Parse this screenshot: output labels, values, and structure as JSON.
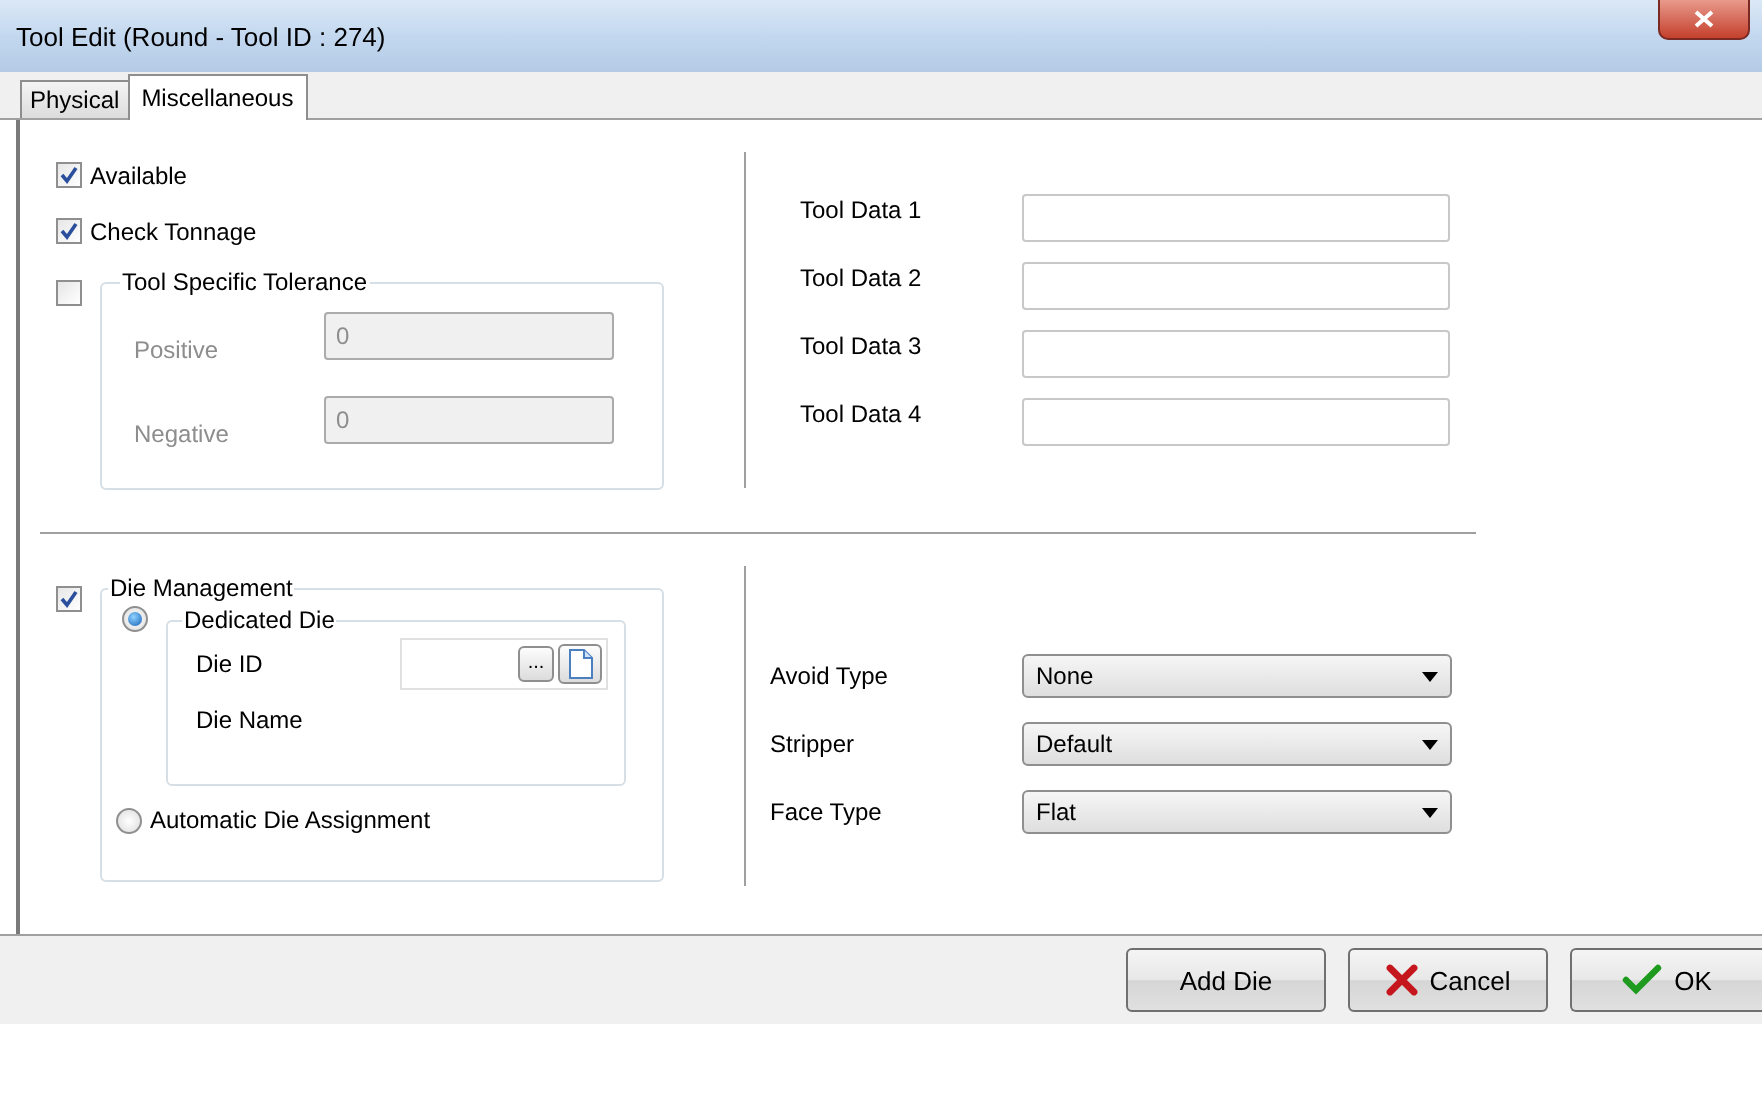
{
  "window": {
    "title": "Tool Edit (Round - Tool ID : 274)"
  },
  "tabs": [
    {
      "label": "Physical",
      "selected": false
    },
    {
      "label": "Miscellaneous",
      "selected": true
    }
  ],
  "options": [
    {
      "label": "Available",
      "checked": true
    },
    {
      "label": "Check Tonnage",
      "checked": true
    }
  ],
  "tolerance": {
    "title": "Tool Specific Tolerance",
    "checked": false,
    "fields": [
      {
        "label": "Positive",
        "value": "0"
      },
      {
        "label": "Negative",
        "value": "0"
      }
    ]
  },
  "tool_data": [
    {
      "label": "Tool Data 1"
    },
    {
      "label": "Tool Data 2"
    },
    {
      "label": "Tool Data 3"
    },
    {
      "label": "Tool Data 4"
    }
  ],
  "die_management": {
    "title": "Die Management",
    "checked": true,
    "browse_button": "...",
    "modes": [
      {
        "label": "Dedicated Die",
        "selected": true
      },
      {
        "label": "Automatic Die Assignment",
        "selected": false
      }
    ],
    "fields": [
      {
        "label": "Die ID"
      },
      {
        "label": "Die Name"
      }
    ]
  },
  "selects": [
    {
      "label": "Avoid Type",
      "value": "None"
    },
    {
      "label": "Stripper",
      "value": "Default"
    },
    {
      "label": "Face Type",
      "value": "Flat"
    }
  ],
  "buttons": [
    {
      "label": "Add Die",
      "kind": "plain"
    },
    {
      "label": "Cancel",
      "kind": "cancel"
    },
    {
      "label": "OK",
      "kind": "ok"
    }
  ]
}
